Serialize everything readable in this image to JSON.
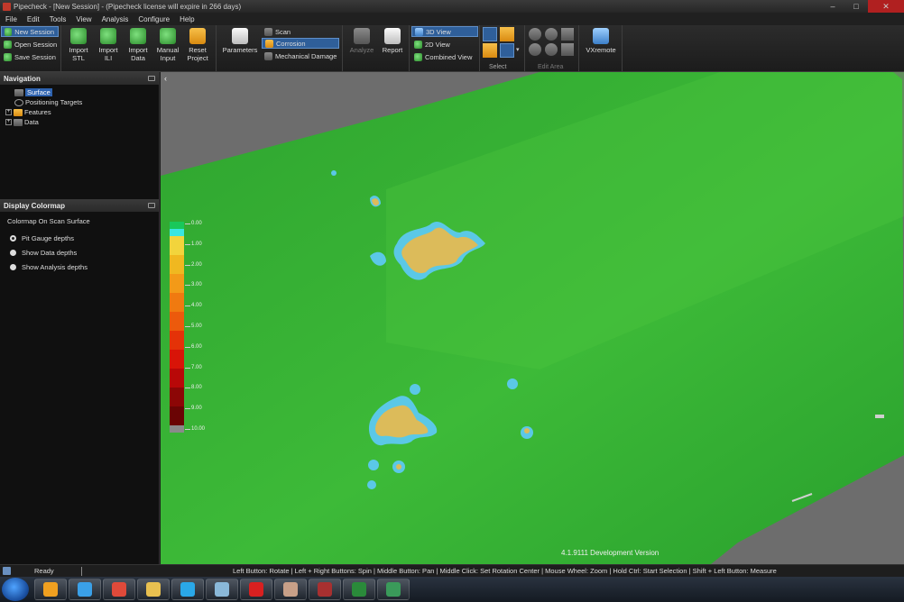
{
  "window": {
    "title": "Pipecheck - [New Session] - (Pipecheck license will expire in 266 days)",
    "controls": [
      "–",
      "□",
      "✕"
    ]
  },
  "menu": [
    "File",
    "Edit",
    "Tools",
    "View",
    "Analysis",
    "Configure",
    "Help"
  ],
  "ribbon": {
    "session": {
      "new": "New Session",
      "open": "Open Session",
      "save": "Save Session"
    },
    "import": [
      {
        "line1": "Import",
        "line2": "STL",
        "icon": "import-stl-icon"
      },
      {
        "line1": "Import",
        "line2": "ILI",
        "icon": "import-ili-icon"
      },
      {
        "line1": "Import",
        "line2": "Data",
        "icon": "import-data-icon"
      },
      {
        "line1": "Manual",
        "line2": "Input",
        "icon": "manual-input-icon"
      },
      {
        "line1": "Reset",
        "line2": "Project",
        "icon": "reset-project-icon"
      }
    ],
    "parameters": "Parameters",
    "modes": {
      "scan": "Scan",
      "corrosion": "Corrosion",
      "mechanical": "Mechanical Damage"
    },
    "analyze": "Analyze",
    "report": "Report",
    "views": {
      "view3d": "3D View",
      "view2d": "2D View",
      "combined": "Combined View"
    },
    "select_label": "Select",
    "edit_area_label": "Edit Area",
    "vxremote": "VXremote"
  },
  "navigation": {
    "header": "Navigation",
    "items": [
      {
        "label": "Surface",
        "selected": true
      },
      {
        "label": "Positioning Targets"
      },
      {
        "label": "Features"
      },
      {
        "label": "Data"
      }
    ]
  },
  "colormap_panel": {
    "header": "Display Colormap",
    "title": "Colormap On Scan Surface",
    "options": [
      "Pit Gauge depths",
      "Show Data depths",
      "Show Analysis depths"
    ],
    "selected_index": 0
  },
  "legend": {
    "colors": [
      "#19c85a",
      "#39e6e0",
      "#f2d43c",
      "#f0b820",
      "#f39a18",
      "#f07a10",
      "#ec5a0c",
      "#e43208",
      "#d81408",
      "#b80808",
      "#8c0606",
      "#6a0404",
      "#8a8a8a"
    ],
    "labels": [
      "0.00",
      "1.00",
      "2.00",
      "3.00",
      "4.00",
      "5.00",
      "6.00",
      "7.00",
      "8.00",
      "9.00",
      "10.00"
    ]
  },
  "viewport": {
    "version_text": "4.1.9111 Development Version",
    "colors": {
      "surface_green": "#2fa832",
      "surface_bright": "#45c03b",
      "background": "#6d6d6d",
      "pit_yellow": "#e0c85a",
      "pit_cyan": "#50c8e8"
    }
  },
  "status": {
    "ready": "Ready",
    "hints": "Left Button: Rotate  |  Left + Right Buttons: Spin  |  Middle Button: Pan  |  Middle Click: Set Rotation Center  |  Mouse Wheel: Zoom  |  Hold Ctrl: Start Selection  |  Shift + Left Button: Measure"
  },
  "taskbar": {
    "apps": [
      {
        "icon": "outlook-icon",
        "color": "#f0a020"
      },
      {
        "icon": "internet-explorer-icon",
        "color": "#3aa0e8"
      },
      {
        "icon": "chrome-icon",
        "color": "#e04a3a"
      },
      {
        "icon": "file-explorer-icon",
        "color": "#e8c050"
      },
      {
        "icon": "skype-icon",
        "color": "#2aa8e8"
      },
      {
        "icon": "notepad-icon",
        "color": "#8ab8d8"
      },
      {
        "icon": "acrobat-icon",
        "color": "#d82020"
      },
      {
        "icon": "paint-icon",
        "color": "#c8a088"
      },
      {
        "icon": "pipecheck-icon",
        "color": "#a83030"
      },
      {
        "icon": "excel-icon",
        "color": "#2a8a3a"
      },
      {
        "icon": "image-viewer-icon",
        "color": "#3a9a5a"
      }
    ]
  }
}
